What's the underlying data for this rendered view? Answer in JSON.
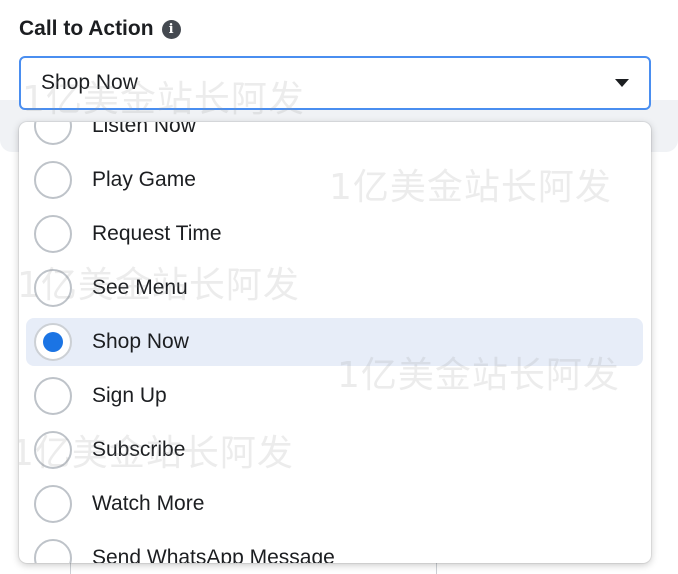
{
  "field": {
    "label": "Call to Action",
    "info_icon_glyph": "i"
  },
  "select": {
    "value": "Shop Now"
  },
  "dropdown": {
    "options": [
      {
        "label": "Listen Now",
        "selected": false
      },
      {
        "label": "Play Game",
        "selected": false
      },
      {
        "label": "Request Time",
        "selected": false
      },
      {
        "label": "See Menu",
        "selected": false
      },
      {
        "label": "Shop Now",
        "selected": true
      },
      {
        "label": "Sign Up",
        "selected": false
      },
      {
        "label": "Subscribe",
        "selected": false
      },
      {
        "label": "Watch More",
        "selected": false
      },
      {
        "label": "Send WhatsApp Message",
        "selected": false
      }
    ]
  },
  "watermark": {
    "text": "1亿美金站长阿发"
  },
  "colors": {
    "accent": "#1b74e4",
    "focus_border": "#4a8ef0",
    "selected_row": "#e7edf8"
  }
}
